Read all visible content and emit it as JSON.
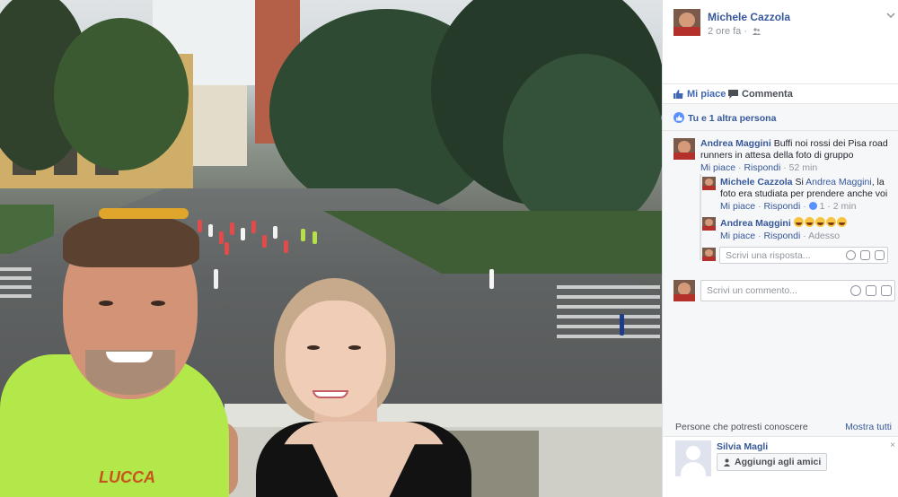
{
  "post": {
    "author": "Michele Cazzola",
    "time": "2 ore fa",
    "privacy_icon": "friends-icon"
  },
  "actions": {
    "like_label": "Mi piace",
    "comment_label": "Commenta"
  },
  "likes": {
    "text": "Tu e 1 altra persona"
  },
  "comments": [
    {
      "author": "Andrea Maggini",
      "text": "Buffi noi rossi dei Pisa road runners in attesa della foto di gruppo",
      "like": "Mi piace",
      "reply": "Rispondi",
      "time": "52 min"
    }
  ],
  "replies": [
    {
      "author": "Michele Cazzola",
      "text_prefix": "Si",
      "mention": "Andrea Maggini",
      "text_suffix": ", la foto era studiata per prendere anche voi",
      "like": "Mi piace",
      "reply": "Rispondi",
      "like_count": "1",
      "time": "2 min"
    },
    {
      "author": "Andrea Maggini",
      "like": "Mi piace",
      "reply": "Rispondi",
      "time": "Adesso",
      "emoji_count": 5
    }
  ],
  "reply_input": {
    "placeholder": "Scrivi una risposta..."
  },
  "comment_input": {
    "placeholder": "Scrivi un commento..."
  },
  "people": {
    "title": "Persone che potresti conoscere",
    "see_all": "Mostra tutti",
    "suggestion_name": "Silvia Magli",
    "add_label": "Aggiungi agli amici",
    "close": "×"
  },
  "photo": {
    "shirt_text": "LUCCA"
  },
  "colors": {
    "link": "#365899",
    "like_blue": "#4267b2",
    "muted": "#90949c",
    "panel_bg": "#f6f7f9"
  }
}
